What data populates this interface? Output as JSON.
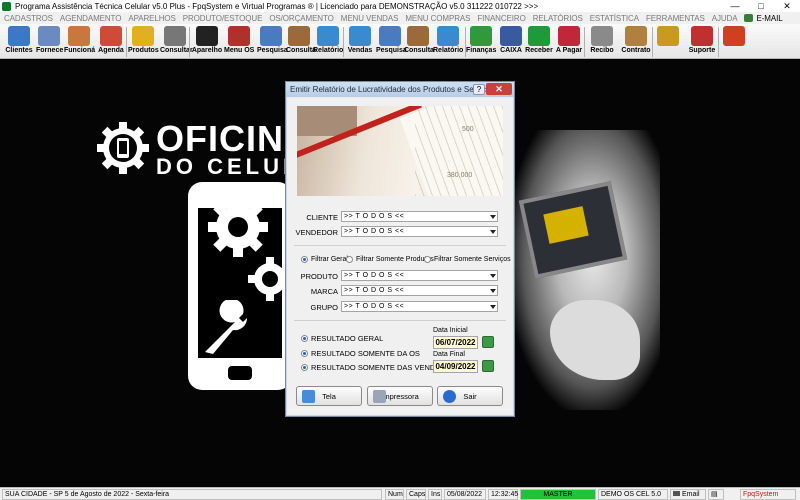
{
  "window": {
    "title": "Programa Assistência Técnica Celular v5.0 Plus - FpqSystem e Virtual Programas ® | Licenciado para  DEMONSTRAÇÃO v5.0 311222 010722 >>>",
    "minimize": "—",
    "maximize": "□",
    "close": "✕"
  },
  "menu": [
    "CADASTROS",
    "AGENDAMENTO",
    "APARELHOS",
    "PRODUTO/ESTOQUE",
    "OS/ORÇAMENTO",
    "MENU VENDAS",
    "MENU COMPRAS",
    "FINANCEIRO",
    "RELATÓRIOS",
    "ESTATÍSTICA",
    "FERRAMENTAS",
    "AJUDA",
    "E-MAIL"
  ],
  "toolbar": [
    {
      "label": "Clientes",
      "icon": "clients-icon",
      "color": "#3c78c8"
    },
    {
      "label": "Fornece",
      "icon": "supplier-icon",
      "color": "#6a8ac0"
    },
    {
      "label": "Funcioná",
      "icon": "employee-icon",
      "color": "#c8783c"
    },
    {
      "label": "Agenda",
      "icon": "calendar-icon",
      "color": "#d04a3a"
    },
    {
      "label": "Produtos",
      "icon": "products-icon",
      "color": "#e0b020"
    },
    {
      "label": "Consultar",
      "icon": "consult-icon",
      "color": "#777777"
    },
    {
      "label": "Aparelho",
      "icon": "device-icon",
      "color": "#222222"
    },
    {
      "label": "Menu OS",
      "icon": "os-icon",
      "color": "#b0302a"
    },
    {
      "label": "Pesquisa",
      "icon": "search-icon",
      "color": "#4a7ac0"
    },
    {
      "label": "Consulta",
      "icon": "consult-icon",
      "color": "#9a6a3a"
    },
    {
      "label": "Relatório",
      "icon": "report-icon",
      "color": "#3a8ad0"
    },
    {
      "label": "Vendas",
      "icon": "sales-icon",
      "color": "#3a8ad0"
    },
    {
      "label": "Pesquisa",
      "icon": "search-icon",
      "color": "#4a7ac0"
    },
    {
      "label": "Consulta",
      "icon": "consult-icon",
      "color": "#9a6a3a"
    },
    {
      "label": "Relatório",
      "icon": "report-icon",
      "color": "#3a8ad0"
    },
    {
      "label": "Finanças",
      "icon": "finance-icon",
      "color": "#2f9a3a"
    },
    {
      "label": "CAIXA",
      "icon": "cashier-icon",
      "color": "#3a5aa0"
    },
    {
      "label": "Receber",
      "icon": "receive-icon",
      "color": "#1f9a3a"
    },
    {
      "label": "A Pagar",
      "icon": "pay-icon",
      "color": "#c0283a"
    },
    {
      "label": "Recibo",
      "icon": "receipt-icon",
      "color": "#8a8a8a"
    },
    {
      "label": "Contrato",
      "icon": "contract-icon",
      "color": "#b08040"
    },
    {
      "label": "",
      "icon": "coins-icon",
      "color": "#c89a20"
    },
    {
      "label": "Suporte",
      "icon": "support-icon",
      "color": "#c03030"
    },
    {
      "label": "",
      "icon": "exit-icon",
      "color": "#d04020"
    }
  ],
  "brand": {
    "title": "OFICINA",
    "subtitle": "DO CELULAR"
  },
  "dialog": {
    "title": "Emitir Relatório de Lucratividade dos Produtos e Serviços",
    "help": "?",
    "close": "✕",
    "hero_numbers": [
      "500",
      "380,000"
    ],
    "fields": {
      "cliente": {
        "label": "CLIENTE",
        "value": ">> T O D O S <<"
      },
      "vendedor": {
        "label": "VENDEDOR",
        "value": ">> T O D O S <<"
      },
      "produto": {
        "label": "PRODUTO",
        "value": ">> T O D O S <<"
      },
      "marca": {
        "label": "MARCA",
        "value": ">> T O D O S <<"
      },
      "grupo": {
        "label": "GRUPO",
        "value": ">> T O D O S <<"
      }
    },
    "filter_options": [
      {
        "label": "Filtrar Geral",
        "selected": true
      },
      {
        "label": "Filtrar Somente Produtos",
        "selected": false
      },
      {
        "label": "Filtrar Somente Serviços",
        "selected": false
      }
    ],
    "result_options": [
      {
        "label": "RESULTADO GERAL",
        "selected": true
      },
      {
        "label": "RESULTADO SOMENTE DA OS",
        "selected": false
      },
      {
        "label": "RESULTADO SOMENTE DAS VENDAS",
        "selected": false
      }
    ],
    "date_start": {
      "label": "Data Inicial",
      "value": "06/07/2022"
    },
    "date_end": {
      "label": "Data Final",
      "value": "04/09/2022"
    },
    "buttons": {
      "tela": "Tela",
      "impressora": "Impressora",
      "sair": "Sair"
    }
  },
  "status": {
    "location": "SUA CIDADE - SP  5 de Agosto de 2022 - Sexta-feira",
    "num": "Num",
    "caps": "Caps",
    "ins": "Ins",
    "date": "05/08/2022",
    "time": "12:32:45",
    "master": "MASTER",
    "version": "DEMO OS CEL 5.0",
    "email": "Email",
    "vendor": "FpqSystem"
  },
  "colors": {
    "accent": "#1d64c8",
    "master_green": "#1fc23a",
    "vendor_red": "#c01818"
  }
}
